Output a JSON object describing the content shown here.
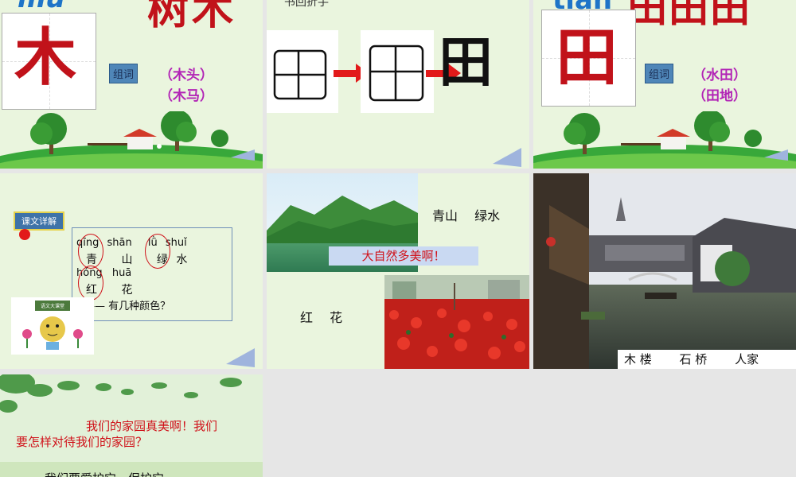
{
  "slides": {
    "mu": {
      "pinyin": "mù",
      "top_chars": "树木",
      "char": "木",
      "zuci_label": "组词",
      "words": [
        "（木头）",
        "（木马）"
      ]
    },
    "stroke": {
      "top_text": "书回折手",
      "result_char": "田"
    },
    "tian": {
      "pinyin": "tián",
      "top_chars": "田田田",
      "char": "田",
      "zuci_label": "组词",
      "words": [
        "（水田）",
        "（田地）"
      ]
    },
    "lesson": {
      "badge": "课文详解",
      "line1_pinyin": [
        "qīng",
        "shān",
        "lǜ",
        "shuǐ"
      ],
      "line1_chars": [
        "青",
        "山",
        "绿",
        "水"
      ],
      "line2_pinyin": [
        "hóng",
        "huā"
      ],
      "line2_chars": [
        "红",
        "花"
      ],
      "question": "—— 有几种颜色？",
      "mini_board": "语文大课堂"
    },
    "nature": {
      "caption_top": "青山　 绿水",
      "banner": "大自然多美啊！",
      "caption_bottom": "红　 花"
    },
    "town": {
      "caption": "木 楼　　 石 桥　　 人家"
    },
    "home": {
      "line1": "我们的家园真美啊！我们",
      "line2": "要怎样对待我们的家园？",
      "line3": "我们要爱护它，保护它。"
    }
  },
  "colors": {
    "slide_bg": "#eaf5de",
    "char_red": "#c1121a",
    "pinyin_blue": "#1e74c8",
    "word_purple": "#b224b6",
    "banner_red": "#d0121a"
  }
}
